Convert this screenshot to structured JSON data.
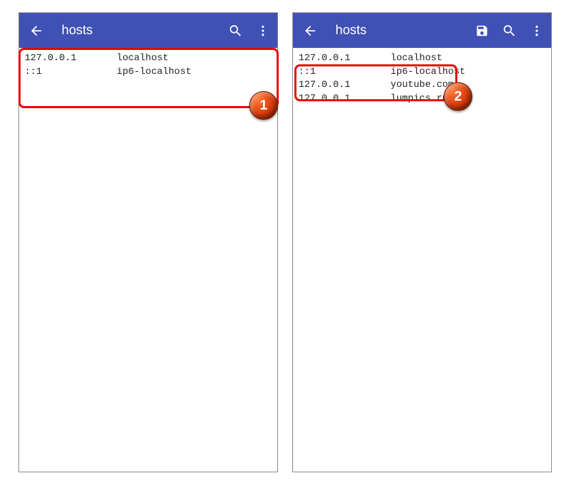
{
  "left": {
    "title": "hosts",
    "content": "127.0.0.1       localhost\n::1             ip6-localhost"
  },
  "right": {
    "title": "hosts",
    "content": "127.0.0.1       localhost\n::1             ip6-localhost\n127.0.0.1       youtube.com\n127.0.0.1       lumpics.ru"
  },
  "badge": {
    "a": "1",
    "b": "2"
  }
}
